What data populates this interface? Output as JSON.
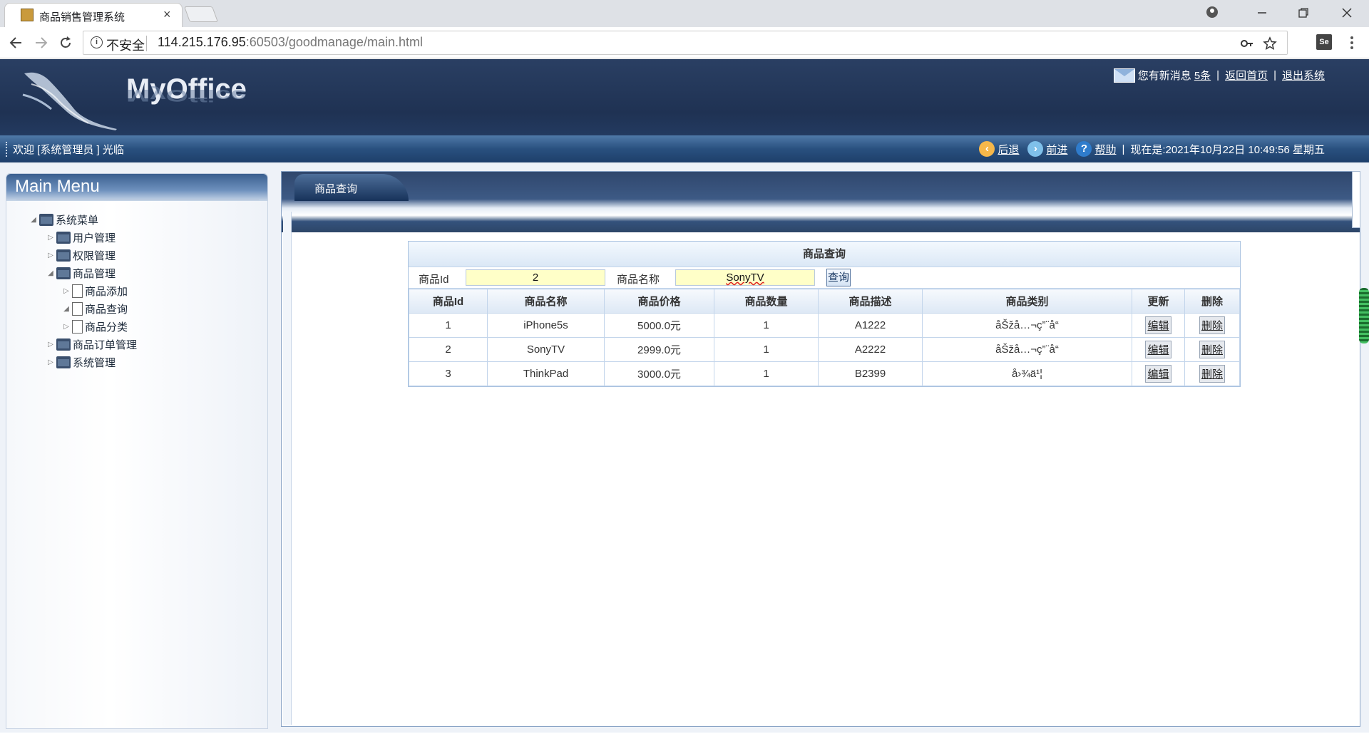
{
  "browser": {
    "tab_title": "商品销售管理系统",
    "tab_close": "×",
    "insecure_label": "不安全",
    "url_host": "114.215.176.95",
    "url_rest": ":60503/goodmanage/main.html",
    "ext_label": "Se"
  },
  "header": {
    "logo": "MyOffice",
    "message_text": "您有新消息",
    "message_count": "5条",
    "home_link": "返回首页",
    "logout_link": "退出系统"
  },
  "status_bar": {
    "welcome": "欢迎 [系统管理员 ] 光临",
    "back": "后退",
    "forward": "前进",
    "help": "帮助",
    "datetime": "现在是:2021年10月22日 10:49:56 星期五"
  },
  "sidebar": {
    "title": "Main Menu",
    "tree": {
      "root": "系统菜单",
      "user_mgmt": "用户管理",
      "perm_mgmt": "权限管理",
      "goods_mgmt": "商品管理",
      "goods_add": "商品添加",
      "goods_query": "商品查询",
      "goods_category": "商品分类",
      "order_mgmt": "商品订单管理",
      "system_mgmt": "系统管理"
    }
  },
  "content": {
    "tab_label": "商品查询",
    "panel_title": "商品查询",
    "form": {
      "id_label": "商品Id",
      "id_value": "2",
      "name_label": "商品名称",
      "name_value": "SonyTV",
      "query_button": "查询"
    },
    "columns": [
      "商品Id",
      "商品名称",
      "商品价格",
      "商品数量",
      "商品描述",
      "商品类别",
      "更新",
      "删除"
    ],
    "rows": [
      [
        "1",
        "iPhone5s",
        "5000.0元",
        "1",
        "A1222",
        "åŠžå…¬ç”¨å“",
        "编辑",
        "删除"
      ],
      [
        "2",
        "SonyTV",
        "2999.0元",
        "1",
        "A2222",
        "åŠžå…¬ç”¨å“",
        "编辑",
        "删除"
      ],
      [
        "3",
        "ThinkPad",
        "3000.0元",
        "1",
        "B2399",
        "å›¾ä¹¦",
        "编辑",
        "删除"
      ]
    ]
  }
}
